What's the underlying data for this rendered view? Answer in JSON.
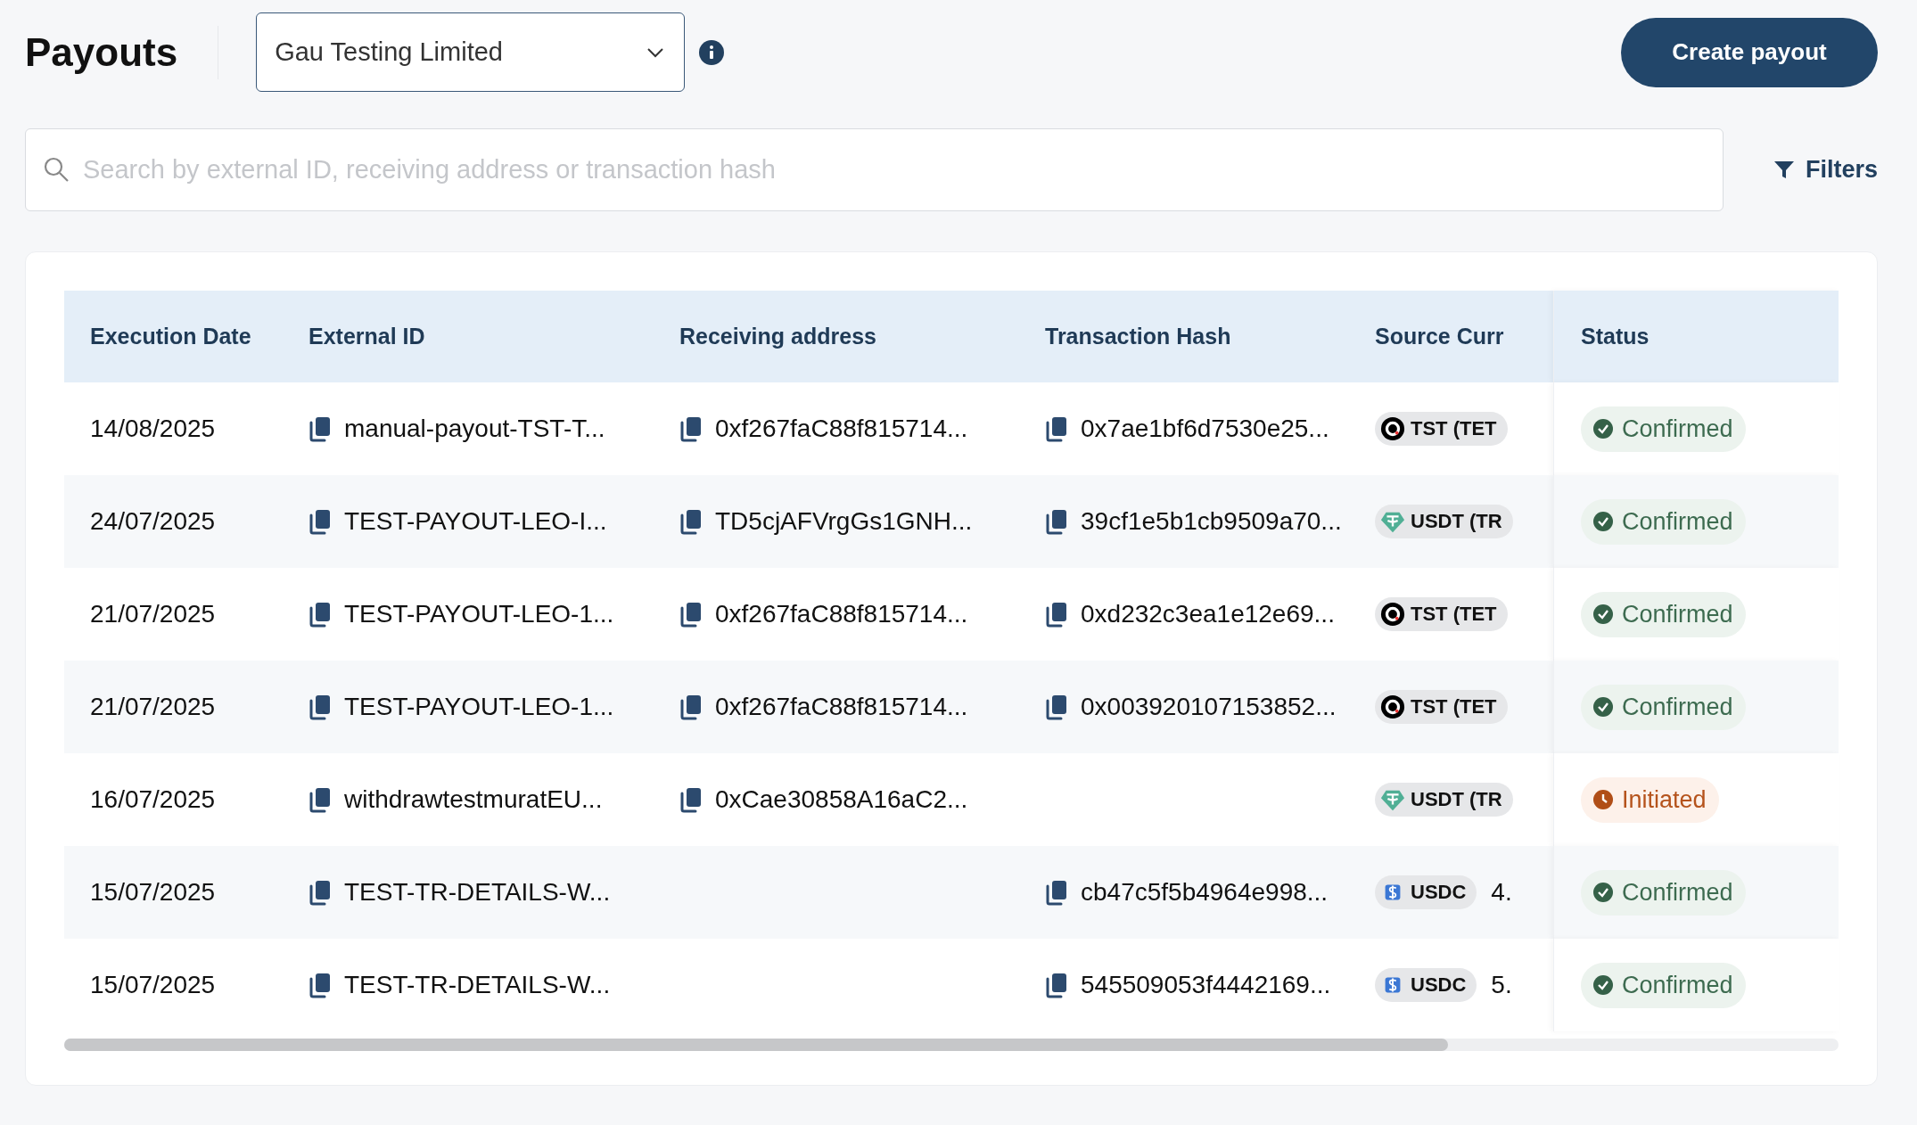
{
  "header": {
    "title": "Payouts",
    "merchant_select": {
      "value": "Gau Testing Limited"
    },
    "create_button": "Create payout"
  },
  "search": {
    "placeholder": "Search by external ID, receiving address or transaction hash"
  },
  "filters_button": "Filters",
  "table": {
    "columns": [
      "Execution Date",
      "External ID",
      "Receiving address",
      "Transaction Hash",
      "Source Curr",
      "Status"
    ],
    "rows": [
      {
        "execution_date": "14/08/2025",
        "external_id": "manual-payout-TST-T...",
        "receiving_address": "0xf267faC88f815714...",
        "transaction_hash": "0x7ae1bf6d7530e25...",
        "currency": {
          "kind": "tst",
          "label": "TST (TET"
        },
        "status": {
          "kind": "confirmed",
          "label": "Confirmed"
        }
      },
      {
        "execution_date": "24/07/2025",
        "external_id": "TEST-PAYOUT-LEO-I...",
        "receiving_address": "TD5cjAFVrgGs1GNH...",
        "transaction_hash": "39cf1e5b1cb9509a70...",
        "currency": {
          "kind": "usdt",
          "label": "USDT (TR"
        },
        "status": {
          "kind": "confirmed",
          "label": "Confirmed"
        }
      },
      {
        "execution_date": "21/07/2025",
        "external_id": "TEST-PAYOUT-LEO-1...",
        "receiving_address": "0xf267faC88f815714...",
        "transaction_hash": "0xd232c3ea1e12e69...",
        "currency": {
          "kind": "tst",
          "label": "TST (TET"
        },
        "status": {
          "kind": "confirmed",
          "label": "Confirmed"
        }
      },
      {
        "execution_date": "21/07/2025",
        "external_id": "TEST-PAYOUT-LEO-1...",
        "receiving_address": "0xf267faC88f815714...",
        "transaction_hash": "0x003920107153852...",
        "currency": {
          "kind": "tst",
          "label": "TST (TET"
        },
        "status": {
          "kind": "confirmed",
          "label": "Confirmed"
        }
      },
      {
        "execution_date": "16/07/2025",
        "external_id": "withdrawtestmuratEU...",
        "receiving_address": "0xCae30858A16aC2...",
        "currency": {
          "kind": "usdt",
          "label": "USDT (TR"
        },
        "status": {
          "kind": "initiated",
          "label": "Initiated"
        }
      },
      {
        "execution_date": "15/07/2025",
        "external_id": "TEST-TR-DETAILS-W...",
        "transaction_hash": "cb47c5f5b4964e998...",
        "currency": {
          "kind": "usdc",
          "label": "USDC"
        },
        "amount": "4.",
        "status": {
          "kind": "confirmed",
          "label": "Confirmed"
        }
      },
      {
        "execution_date": "15/07/2025",
        "external_id": "TEST-TR-DETAILS-W...",
        "transaction_hash": "545509053f4442169...",
        "currency": {
          "kind": "usdc",
          "label": "USDC"
        },
        "amount": "5.",
        "status": {
          "kind": "confirmed",
          "label": "Confirmed"
        }
      }
    ]
  }
}
